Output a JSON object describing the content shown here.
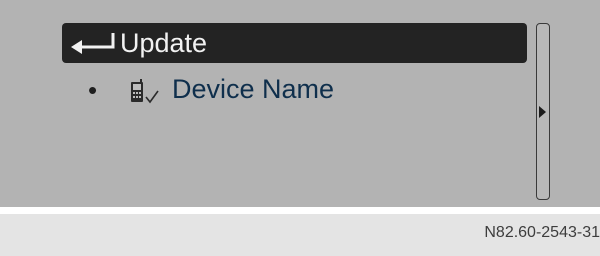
{
  "menu": {
    "selected_item_label": "Update",
    "device_name": "Device Name",
    "bullet": "•"
  },
  "icons": {
    "back": "return-arrow-icon",
    "device": "phone-check-icon",
    "scroll": "right-arrow-icon"
  },
  "colors": {
    "screen_bg": "#b3b3b3",
    "selection_bg": "#232323",
    "selection_text": "#f2f2f2",
    "device_text": "#0f2f4c",
    "footer_bg": "#e4e4e4"
  },
  "footer": {
    "figure_code": "N82.60-2543-31"
  }
}
